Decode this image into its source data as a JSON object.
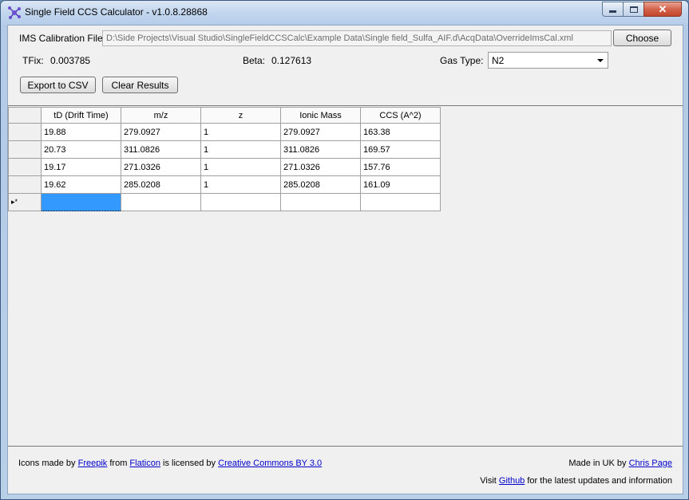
{
  "window": {
    "title": "Single Field CCS Calculator - v1.0.8.28868"
  },
  "calibration": {
    "label": "IMS Calibration File:",
    "path": "D:\\Side Projects\\Visual Studio\\SingleFieldCCSCalc\\Example Data\\Single field_Sulfa_AIF.d\\AcqData\\OverrideImsCal.xml",
    "choose_label": "Choose"
  },
  "params": {
    "tfix_label": "TFix:",
    "tfix_value": "0.003785",
    "beta_label": "Beta:",
    "beta_value": "0.127613",
    "gas_label": "Gas Type:",
    "gas_value": "N2"
  },
  "actions": {
    "export_label": "Export to CSV",
    "clear_label": "Clear Results"
  },
  "grid": {
    "columns": [
      "tD (Drift Time)",
      "m/z",
      "z",
      "Ionic Mass",
      "CCS (A^2)"
    ],
    "rows": [
      [
        "19.88",
        "279.0927",
        "1",
        "279.0927",
        "163.38"
      ],
      [
        "20.73",
        "311.0826",
        "1",
        "311.0826",
        "169.57"
      ],
      [
        "19.17",
        "271.0326",
        "1",
        "271.0326",
        "157.76"
      ],
      [
        "19.62",
        "285.0208",
        "1",
        "285.0208",
        "161.09"
      ]
    ],
    "new_row_marker": "▸*"
  },
  "footer": {
    "icons_prefix": "Icons made by",
    "freepik": "Freepik",
    "from": "from",
    "flaticon": "Flaticon",
    "licensed": "is licensed by",
    "cc": "Creative Commons BY 3.0",
    "made_in": "Made in UK by",
    "author": "Chris Page",
    "visit": "Visit",
    "github": "Github",
    "updates": "for the latest updates and information"
  }
}
